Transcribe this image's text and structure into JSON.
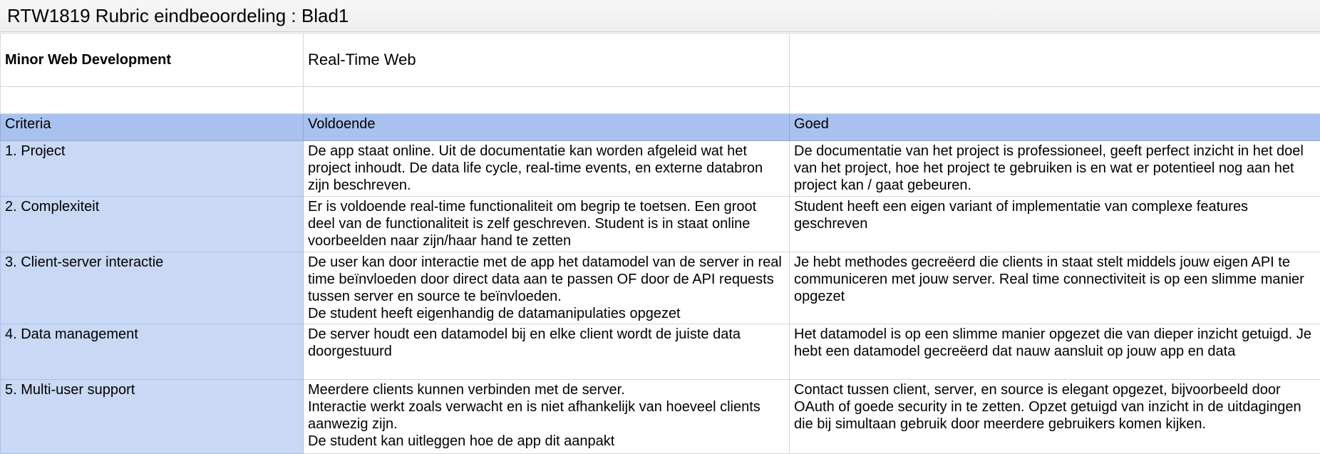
{
  "window": {
    "title": "RTW1819 Rubric eindbeoordeling : Blad1"
  },
  "sheet": {
    "minor": "Minor Web Development",
    "course": "Real-Time Web",
    "headers": {
      "criteria": "Criteria",
      "voldoende": "Voldoende",
      "goed": "Goed"
    },
    "rows": [
      {
        "criterion": "1. Project",
        "voldoende": "De app staat online. Uit de documentatie kan worden afgeleid wat het project inhoudt. De data life cycle, real-time events, en externe databron zijn beschreven.",
        "goed": "De documentatie van het project is professioneel, geeft perfect inzicht in het doel van het project, hoe het project te gebruiken is en wat er potentieel nog aan het project kan / gaat gebeuren."
      },
      {
        "criterion": "2. Complexiteit",
        "voldoende": "Er is voldoende real-time functionaliteit om begrip te toetsen. Een groot deel van de functionaliteit is zelf geschreven. Student is in staat online voorbeelden naar zijn/haar hand te zetten",
        "goed": "Student heeft een eigen variant of implementatie van complexe features geschreven"
      },
      {
        "criterion": "3. Client-server interactie",
        "voldoende": "De user kan door interactie met de app het datamodel van de server in real time beïnvloeden door direct data aan te passen OF door de API requests tussen server en source te beïnvloeden.",
        "voldoende_2": "De student heeft eigenhandig de datamanipulaties opgezet",
        "goed": "Je hebt methodes gecreëerd die clients in staat stelt middels jouw eigen API te communiceren met jouw server. Real time connectiviteit is op een slimme manier opgezet"
      },
      {
        "criterion": "4. Data management",
        "voldoende": "De server houdt een datamodel bij en elke client wordt de juiste data doorgestuurd",
        "goed": "Het datamodel is op een slimme manier opgezet die van dieper inzicht getuigd. Je hebt een datamodel gecreëerd dat nauw aansluit op jouw app en data"
      },
      {
        "criterion": "5. Multi-user support",
        "voldoende": "Meerdere clients kunnen verbinden met de server.",
        "voldoende_2": "Interactie werkt zoals verwacht en is niet afhankelijk van hoeveel clients aanwezig zijn.",
        "voldoende_3": "De student kan uitleggen hoe de app dit aanpakt",
        "goed": "Contact tussen client, server, en source is elegant opgezet, bijvoorbeeld door OAuth of goede security in te zetten. Opzet getuigd van inzicht in de uitdagingen die bij simultaan gebruik door meerdere gebruikers komen kijken."
      }
    ]
  }
}
